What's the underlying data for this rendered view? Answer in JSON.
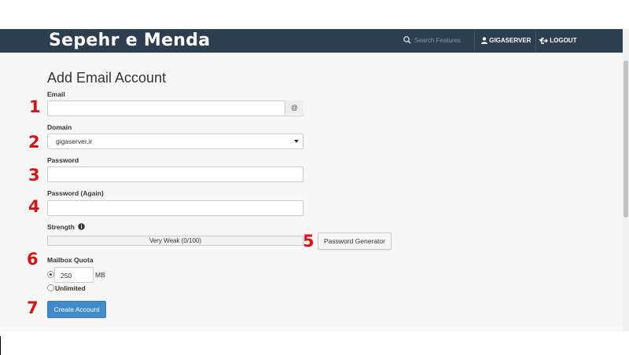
{
  "header": {
    "brand": "Sepehr e Menda",
    "search_placeholder": "Search Features",
    "user": "GIGASERVER",
    "logout": "LOGOUT"
  },
  "form": {
    "title": "Add Email Account",
    "email_label": "Email",
    "email_value": "",
    "email_addon": "@",
    "domain_label": "Domain",
    "domain_value": "gigaserver.ir",
    "password_label": "Password",
    "password_again_label": "Password (Again)",
    "strength_label": "Strength",
    "strength_text": "Very Weak (0/100)",
    "strength_value": 0,
    "password_generator": "Password Generator",
    "quota_label": "Mailbox Quota",
    "quota_value": "250",
    "quota_unit": "MB",
    "unlimited_label": "Unlimited",
    "create_button": "Create Account"
  },
  "annotations": [
    "1",
    "2",
    "3",
    "4",
    "5",
    "6",
    "7"
  ],
  "colors": {
    "header_bg": "#2c3e50",
    "primary_button": "#428bca",
    "annotation_red": "#d61317"
  }
}
